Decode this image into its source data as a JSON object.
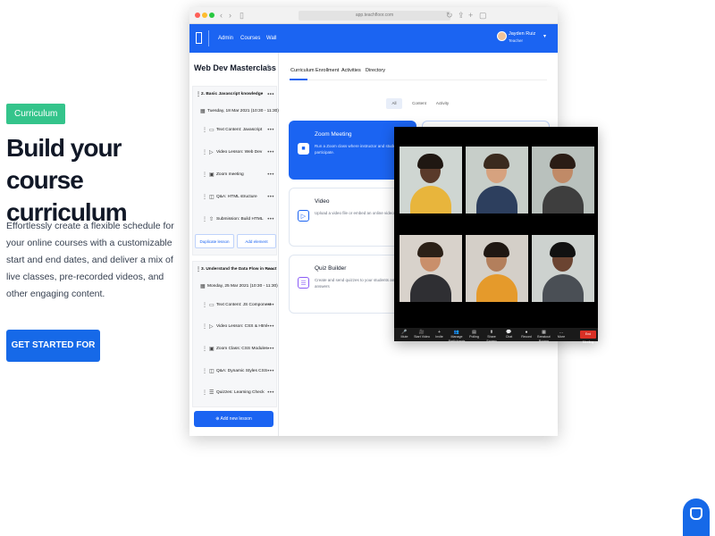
{
  "hero": {
    "badge": "Curriculum",
    "title": "Build your course curriculum",
    "description": "Effortlessly create a flexible schedule for your online courses with a customizable start and end dates, and deliver a mix of live classes, pre-recorded videos, and other engaging content.",
    "cta_label": "GET STARTED FOR FREE"
  },
  "browser": {
    "address": "app.teachfloor.com",
    "nav": [
      "Admin",
      "Courses",
      "Wall"
    ],
    "user": {
      "name": "Jayden Ruiz",
      "role": "Teacher"
    },
    "course_title": "Web Dev Masterclass",
    "sections": [
      {
        "title": "2. Basic Javascript knowledge",
        "date": "Tuesday, 18 Mar 2021 (10:30 - 11:30)",
        "items": [
          {
            "label": "Text Content: Javascript",
            "icon": "doc-icon"
          },
          {
            "label": "Video Lesson: Web Dev",
            "icon": "play-icon"
          },
          {
            "label": "Zoom meeting",
            "icon": "camera-icon"
          },
          {
            "label": "Q&A: HTML structure",
            "icon": "chat-icon"
          },
          {
            "label": "Submission: Build HTML",
            "icon": "upload-icon"
          }
        ],
        "actions": [
          "Duplicate lesson",
          "Add element"
        ]
      },
      {
        "title": "3. Understand the Data Flow in React",
        "date": "Monday, 25 Mar 2021 (10:30 - 11:30)",
        "items": [
          {
            "label": "Text Content: JS Component",
            "icon": "doc-icon"
          },
          {
            "label": "Video Lesson: CSS & Html",
            "icon": "play-icon"
          },
          {
            "label": "Zoom Class: CSS Modules",
            "icon": "camera-icon"
          },
          {
            "label": "Q&A: Dynamic Styles CSS",
            "icon": "chat-icon"
          },
          {
            "label": "Quizzes: Learning Check",
            "icon": "quiz-icon"
          }
        ]
      }
    ],
    "add_lesson_label": "Add new lesson",
    "tabs": [
      "Curriculum",
      "Enrollment",
      "Activities",
      "Directory"
    ],
    "filters": [
      "All",
      "Content",
      "Activity"
    ],
    "cards": [
      {
        "title": "Zoom Meeting",
        "description": "Run a Zoom class where instructor and students participate.",
        "icon": "camera-icon",
        "accent": "#1b64f2"
      },
      {
        "title": "Video",
        "description": "Upload a video file or embed an online video",
        "icon": "play-icon",
        "accent": "#1b64f2"
      },
      {
        "title": "Quiz Builder",
        "description": "Create and send quizzes to your students and see answers",
        "icon": "quiz-icon",
        "accent": "#8b5cf6"
      }
    ]
  },
  "zoom": {
    "participants": [
      {
        "bg": "#cfd6d2",
        "skin": "#5a3a2a",
        "hair": "#1f1712",
        "shirt": "#e8b53c"
      },
      {
        "bg": "#c7cec9",
        "skin": "#d6a27f",
        "hair": "#3a2a1e",
        "shirt": "#2d3f5e"
      },
      {
        "bg": "#b9c1bd",
        "skin": "#c08a67",
        "hair": "#2a1c15",
        "shirt": "#3e3e3e"
      },
      {
        "bg": "#d8d2cb",
        "skin": "#c98f6b",
        "hair": "#2b2017",
        "shirt": "#2f2f33"
      },
      {
        "bg": "#d4cfc8",
        "skin": "#b37f5c",
        "hair": "#1f1712",
        "shirt": "#e59a2b"
      },
      {
        "bg": "#cdd2cf",
        "skin": "#6b4431",
        "hair": "#111111",
        "shirt": "#4a4f55"
      }
    ],
    "toolbar": [
      {
        "label": "Mute",
        "glyph": "🎤"
      },
      {
        "label": "Start Video",
        "glyph": "🎥"
      },
      {
        "label": "Invite",
        "glyph": "+"
      },
      {
        "label": "Manage Participants",
        "glyph": "👥"
      },
      {
        "label": "Polling",
        "glyph": "▤"
      },
      {
        "label": "Share Screen",
        "glyph": "⬆"
      },
      {
        "label": "Chat",
        "glyph": "💬"
      },
      {
        "label": "Record",
        "glyph": "●"
      },
      {
        "label": "Breakout Rooms",
        "glyph": "▦"
      },
      {
        "label": "More",
        "glyph": "…"
      }
    ],
    "end_label": "End Meeting"
  },
  "colors": {
    "accent": "#1b64f2",
    "badge": "#34c48b",
    "cta": "#1669e8"
  }
}
